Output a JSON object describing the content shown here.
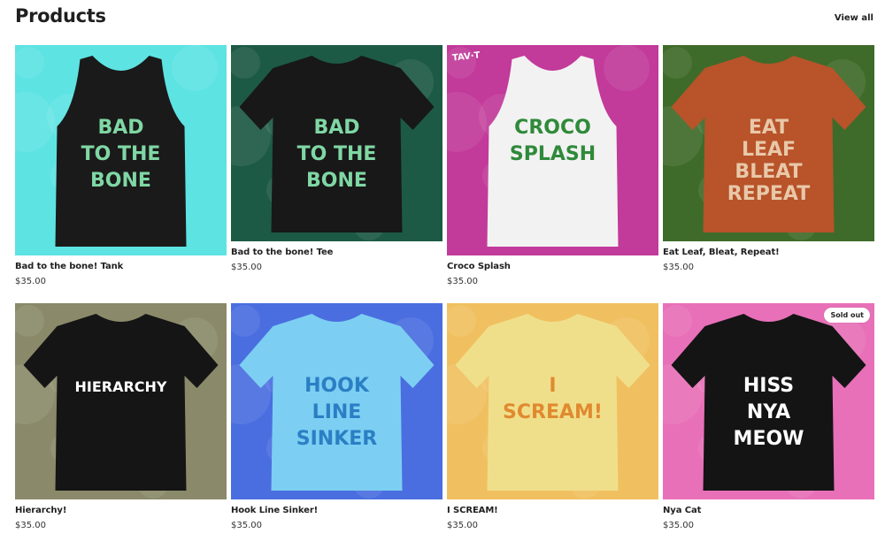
{
  "header": {
    "title": "Products",
    "view_all": "View all"
  },
  "products": [
    {
      "name": "Bad to the bone! Tank",
      "price": "$35.00",
      "bg": "#5ee3e3",
      "shirt": "#1a1a1a",
      "garment": "tank",
      "accent": "#7fd7a4",
      "art_lines": [
        "BAD",
        "TO THE",
        "BONE"
      ],
      "sold_out": false
    },
    {
      "name": "Bad to the bone! Tee",
      "price": "$35.00",
      "bg": "#1d5a45",
      "shirt": "#181818",
      "garment": "tee",
      "accent": "#7fd7a4",
      "art_lines": [
        "BAD",
        "TO THE",
        "BONE"
      ],
      "sold_out": false
    },
    {
      "name": "Croco Splash",
      "price": "$35.00",
      "bg": "#c23a9a",
      "shirt": "#f2f2f2",
      "garment": "tank",
      "accent": "#2f8a3a",
      "art_lines": [
        "CROCO",
        "SPLASH"
      ],
      "sold_out": false,
      "corner_logo": "TAV·T"
    },
    {
      "name": "Eat Leaf, Bleat, Repeat!",
      "price": "$35.00",
      "bg": "#3f6b2a",
      "shirt": "#b8532a",
      "garment": "tee",
      "accent": "#e8c8a8",
      "art_lines": [
        "EAT",
        "LEAF",
        "BLEAT",
        "REPEAT"
      ],
      "sold_out": false
    },
    {
      "name": "Hierarchy!",
      "price": "$35.00",
      "bg": "#8a8a6a",
      "shirt": "#151515",
      "garment": "tee",
      "accent": "#ffffff",
      "art_lines": [
        "HIERARCHY"
      ],
      "sold_out": false
    },
    {
      "name": "Hook Line Sinker!",
      "price": "$35.00",
      "bg": "#4a6ee0",
      "shirt": "#7ccff2",
      "garment": "tee",
      "accent": "#2a7fc4",
      "art_lines": [
        "HOOK",
        "LINE",
        "SINKER"
      ],
      "sold_out": false
    },
    {
      "name": "I SCREAM!",
      "price": "$35.00",
      "bg": "#f0c060",
      "shirt": "#f0df8a",
      "garment": "tee",
      "accent": "#e08a30",
      "art_lines": [
        "I",
        "SCREAM!"
      ],
      "sold_out": false
    },
    {
      "name": "Nya Cat",
      "price": "$35.00",
      "bg": "#e870b8",
      "shirt": "#141414",
      "garment": "tee",
      "accent": "#ffffff",
      "art_lines": [
        "HISS",
        "NYA",
        "MEOW"
      ],
      "sold_out": true,
      "sold_out_label": "Sold out"
    }
  ]
}
